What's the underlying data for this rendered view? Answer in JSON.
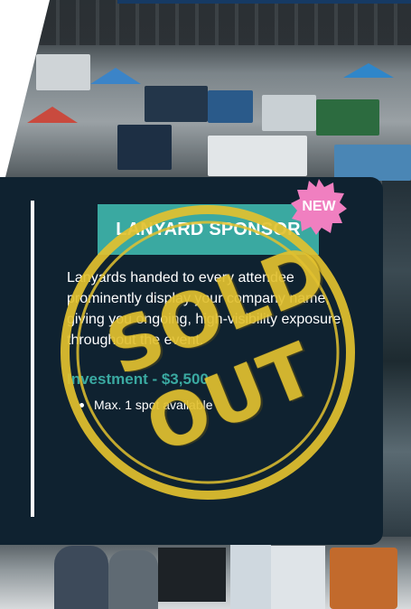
{
  "card": {
    "tag_label": "LANYARD SPONSOR",
    "description": "Lanyards handed to every attendee prominently display your company name, giving you ongoing, high-visibility exposure throughout the event.",
    "investment_label": "Investment - $3,500",
    "bullets": [
      "Max. 1 spot available"
    ]
  },
  "badge": {
    "label": "NEW"
  },
  "stamp": {
    "line1": "SOLD",
    "line2": "OUT"
  },
  "colors": {
    "card_bg": "#0f2230",
    "accent_teal": "#3aa9a1",
    "badge_pink": "#f07fc0",
    "stamp_gold": "#e2c12f"
  }
}
